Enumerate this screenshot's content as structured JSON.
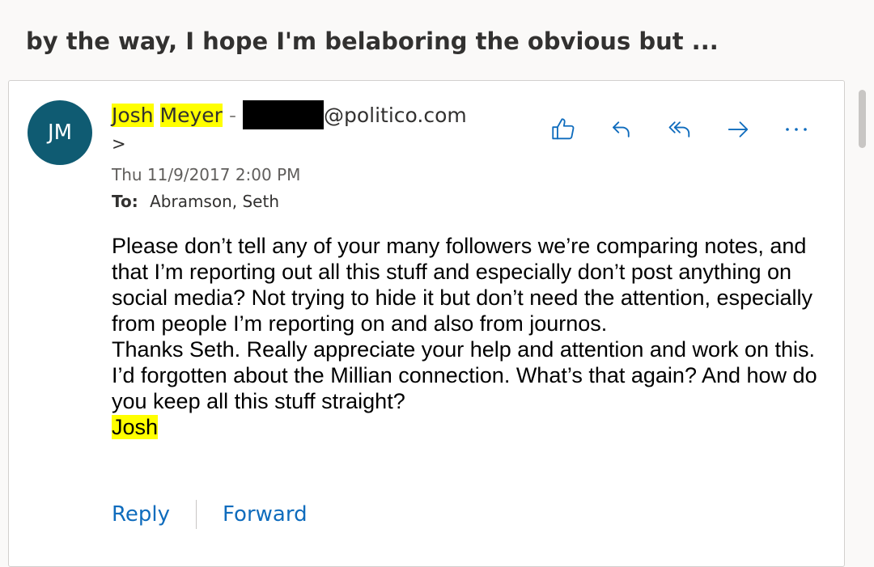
{
  "subject": "by the way, I hope I'm belaboring the obvious but ...",
  "message": {
    "avatar_initials": "JM",
    "sender": {
      "first_name": "Josh",
      "last_name": "Meyer",
      "separator": "-",
      "email_domain": "@politico.com",
      "trailing": ">"
    },
    "date": "Thu 11/9/2017 2:00 PM",
    "to_label": "To:",
    "to_value": "Abramson, Seth",
    "body": {
      "para1": "Please don’t tell any of your many followers we’re comparing notes, and that I’m reporting out all this stuff and especially don’t post anything on social media? Not trying to hide it but don’t need the attention, especially from people I’m reporting on and also from journos.",
      "para2": "Thanks Seth. Really appreciate your help and attention and work on this. I’d forgotten about the Millian connection. What’s that again? And how do you keep all this stuff straight?",
      "signature": "Josh"
    },
    "actions": {
      "reply_label": "Reply",
      "forward_label": "Forward"
    }
  },
  "icons": [
    "like-icon",
    "reply-icon",
    "reply-all-icon",
    "forward-icon",
    "more-icon"
  ],
  "colors": {
    "accent": "#0f6cbd",
    "avatar": "#0f5b72",
    "highlight": "#ffff00"
  }
}
